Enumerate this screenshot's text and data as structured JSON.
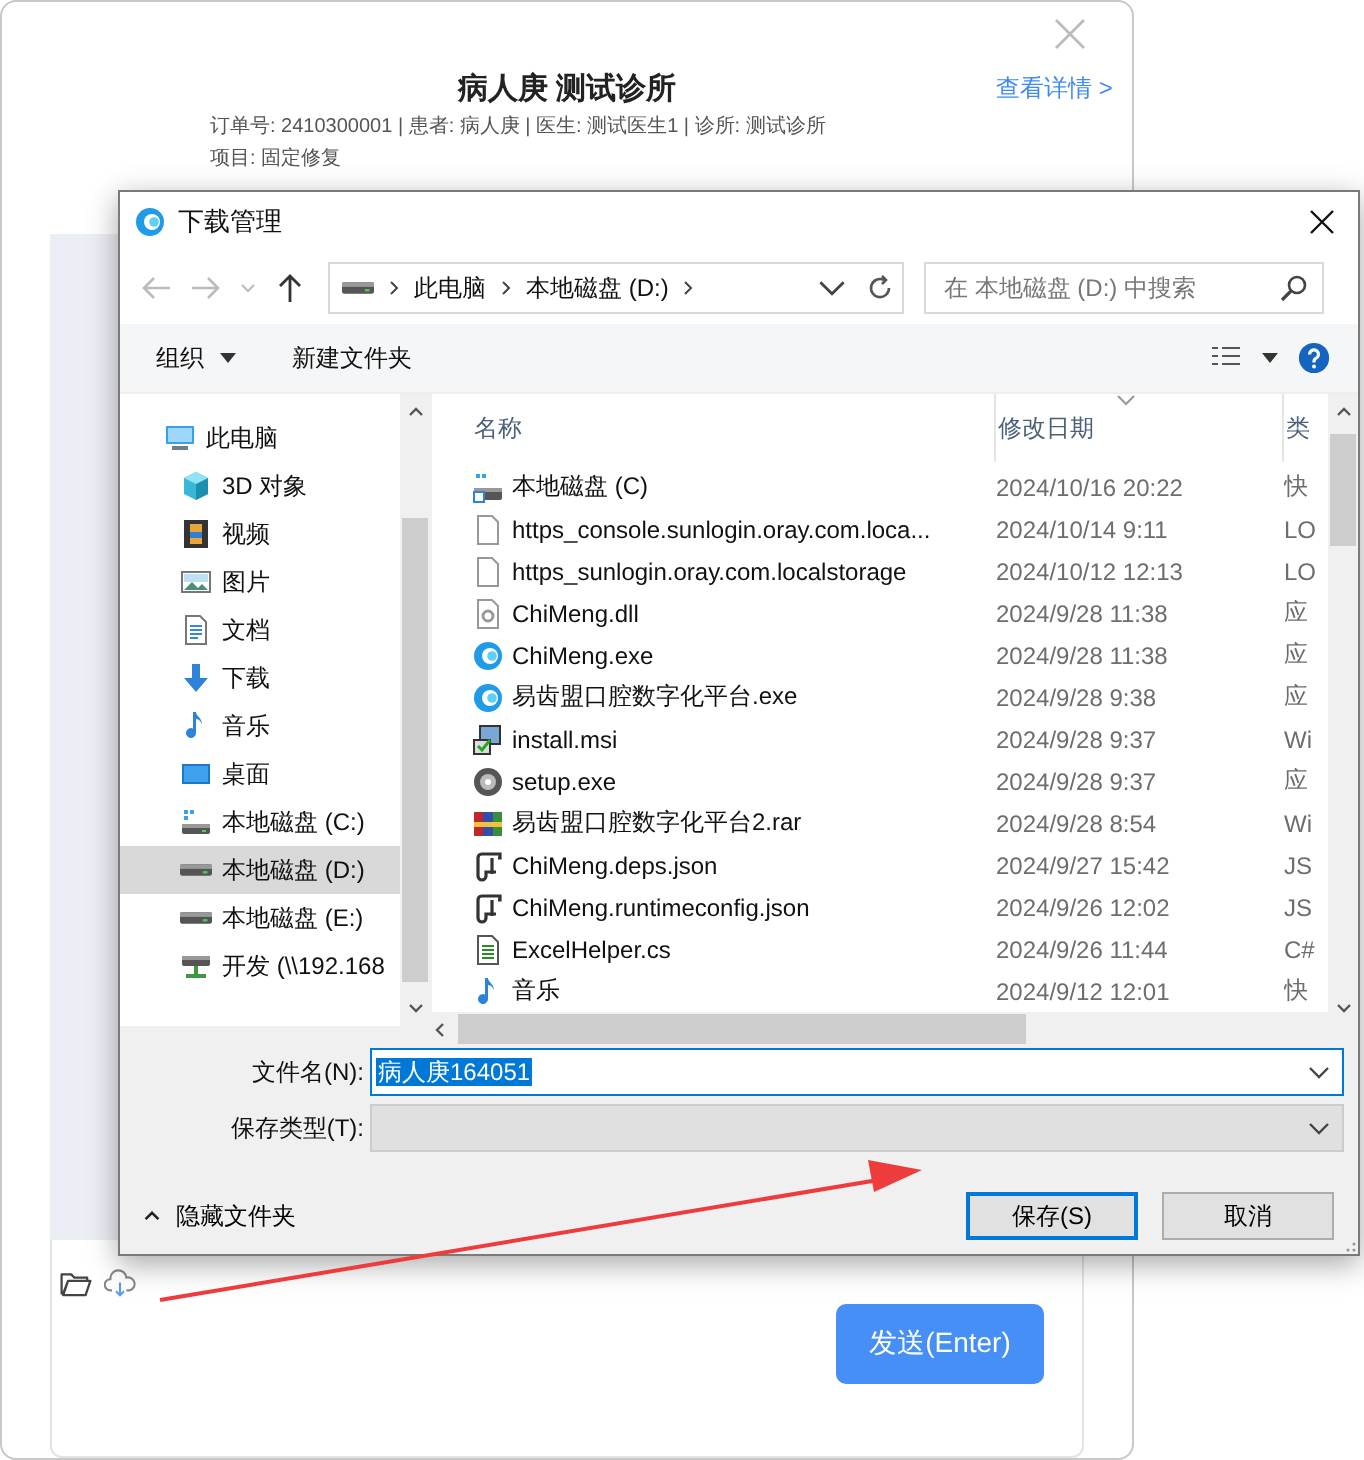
{
  "app": {
    "title": "病人庚 测试诊所",
    "details_link": "查看详情 >",
    "info_lines": [
      "订单号: 2410300001 | 患者: 病人庚 | 医生: 测试医生1 | 诊所: 测试诊所",
      "项目: 固定修复"
    ],
    "send_button": "发送(Enter)"
  },
  "dialog": {
    "title": "下载管理",
    "breadcrumb": [
      "此电脑",
      "本地磁盘 (D:)"
    ],
    "search": {
      "placeholder": "在 本地磁盘 (D:) 中搜索"
    },
    "toolbar": [
      {
        "label": "组织",
        "kind": "menu"
      },
      {
        "label": "新建文件夹",
        "kind": "button"
      }
    ],
    "nav_tree": [
      {
        "label": "此电脑",
        "kind": "computer",
        "selected": false,
        "children": [
          {
            "label": "3D 对象",
            "kind": "cube",
            "selected": false
          },
          {
            "label": "视频",
            "kind": "video",
            "selected": false
          },
          {
            "label": "图片",
            "kind": "picture",
            "selected": false
          },
          {
            "label": "文档",
            "kind": "document",
            "selected": false
          },
          {
            "label": "下载",
            "kind": "download",
            "selected": false
          },
          {
            "label": "音乐",
            "kind": "music",
            "selected": false
          },
          {
            "label": "桌面",
            "kind": "desktop",
            "selected": false
          },
          {
            "label": "本地磁盘 (C:)",
            "kind": "system-drive",
            "selected": false
          },
          {
            "label": "本地磁盘 (D:)",
            "kind": "drive",
            "selected": true
          },
          {
            "label": "本地磁盘 (E:)",
            "kind": "drive",
            "selected": false
          },
          {
            "label": "开发 (\\\\192.168",
            "kind": "network-drive",
            "selected": false
          }
        ]
      }
    ],
    "columns": [
      {
        "label": "名称",
        "sorted": false
      },
      {
        "label": "修改日期",
        "sorted": true
      },
      {
        "label": "类",
        "sorted": false
      }
    ],
    "files": [
      {
        "name": "本地磁盘 (C)",
        "date": "2024/10/16 20:22",
        "type": "快",
        "kind": "shortcut",
        "selected": false
      },
      {
        "name": "https_console.sunlogin.oray.com.loca...",
        "date": "2024/10/14 9:11",
        "type": "LO",
        "kind": "file",
        "selected": false
      },
      {
        "name": "https_sunlogin.oray.com.localstorage",
        "date": "2024/10/12 12:13",
        "type": "LO",
        "kind": "file",
        "selected": false
      },
      {
        "name": "ChiMeng.dll",
        "date": "2024/9/28 11:38",
        "type": "应",
        "kind": "dll",
        "selected": false
      },
      {
        "name": "ChiMeng.exe",
        "date": "2024/9/28 11:38",
        "type": "应",
        "kind": "app",
        "selected": false
      },
      {
        "name": "易齿盟口腔数字化平台.exe",
        "date": "2024/9/28 9:38",
        "type": "应",
        "kind": "app",
        "selected": false
      },
      {
        "name": "install.msi",
        "date": "2024/9/28 9:37",
        "type": "Wi",
        "kind": "installer",
        "selected": false
      },
      {
        "name": "setup.exe",
        "date": "2024/9/28 9:37",
        "type": "应",
        "kind": "setup",
        "selected": false
      },
      {
        "name": "易齿盟口腔数字化平台2.rar",
        "date": "2024/9/28 8:54",
        "type": "Wi",
        "kind": "archive",
        "selected": false
      },
      {
        "name": "ChiMeng.deps.json",
        "date": "2024/9/27 15:42",
        "type": "JS",
        "kind": "json",
        "selected": false
      },
      {
        "name": "ChiMeng.runtimeconfig.json",
        "date": "2024/9/26 12:02",
        "type": "JS",
        "kind": "json",
        "selected": false
      },
      {
        "name": "ExcelHelper.cs",
        "date": "2024/9/26 11:44",
        "type": "C#",
        "kind": "code",
        "selected": false
      },
      {
        "name": "音乐",
        "date": "2024/9/12 12:01",
        "type": "快",
        "kind": "music",
        "selected": false
      }
    ],
    "file_name": {
      "label": "文件名(N):",
      "value": "病人庚164051",
      "text_selected": true
    },
    "file_type": {
      "label": "保存类型(T):",
      "disabled": true
    },
    "hide_folders": "隐藏文件夹",
    "buttons": [
      {
        "label": "保存(S)",
        "default": true
      },
      {
        "label": "取消",
        "default": false
      }
    ]
  }
}
